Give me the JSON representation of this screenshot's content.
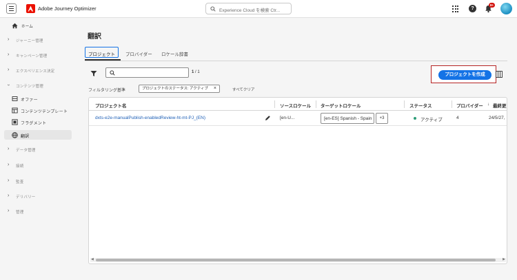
{
  "header": {
    "app_title": "Adobe Journey Optimizer",
    "search_placeholder": "Experience Cloud を検索 Ctr...",
    "notification_count": "9+"
  },
  "sidebar": {
    "home": "ホーム",
    "items": [
      {
        "label": "ジャーニー管理"
      },
      {
        "label": "キャンペーン管理"
      },
      {
        "label": "エクスペリエンス決定"
      },
      {
        "label": "コンテンツ管理"
      }
    ],
    "sub_items": [
      {
        "label": "オファー",
        "icon": "offer-icon"
      },
      {
        "label": "コンテンツテンプレート",
        "icon": "template-icon"
      },
      {
        "label": "フラグメント",
        "icon": "fragment-icon"
      },
      {
        "label": "翻訳",
        "icon": "globe-icon"
      }
    ],
    "lower_items": [
      {
        "label": "データ管理"
      },
      {
        "label": "接続"
      },
      {
        "label": "監査"
      },
      {
        "label": "デリバリー"
      },
      {
        "label": "管理"
      }
    ]
  },
  "page": {
    "title": "翻訳",
    "tabs": [
      "プロジェクト",
      "プロバイダー",
      "ロケール辞書"
    ],
    "pager_current": "1",
    "pager_total": "1",
    "create_button": "プロジェクトを作成",
    "filter_label": "フィルタリング基準",
    "filter_chip": "プロジェクトのステータス: アクティブ",
    "clear_all": "すべてクリア"
  },
  "table": {
    "columns": [
      "プロジェクト名",
      "ソースロケール",
      "ターゲットロケール",
      "ステータス",
      "プロバイダー",
      "最終更"
    ],
    "rows": [
      {
        "name": "dxts-e2e-manualPublish-enabledReview-ht-mt-PJ_(EN)",
        "source": "[en-U...",
        "target": "[en-ES] Spanish - Spain",
        "more": "+3",
        "status": "アクティブ",
        "providers": "4",
        "updated": "24/5/27,"
      }
    ]
  },
  "colors": {
    "accent": "#1473e6",
    "brand": "#eb1000",
    "status_active": "#2d9d78",
    "highlight_box": "#b52222"
  }
}
